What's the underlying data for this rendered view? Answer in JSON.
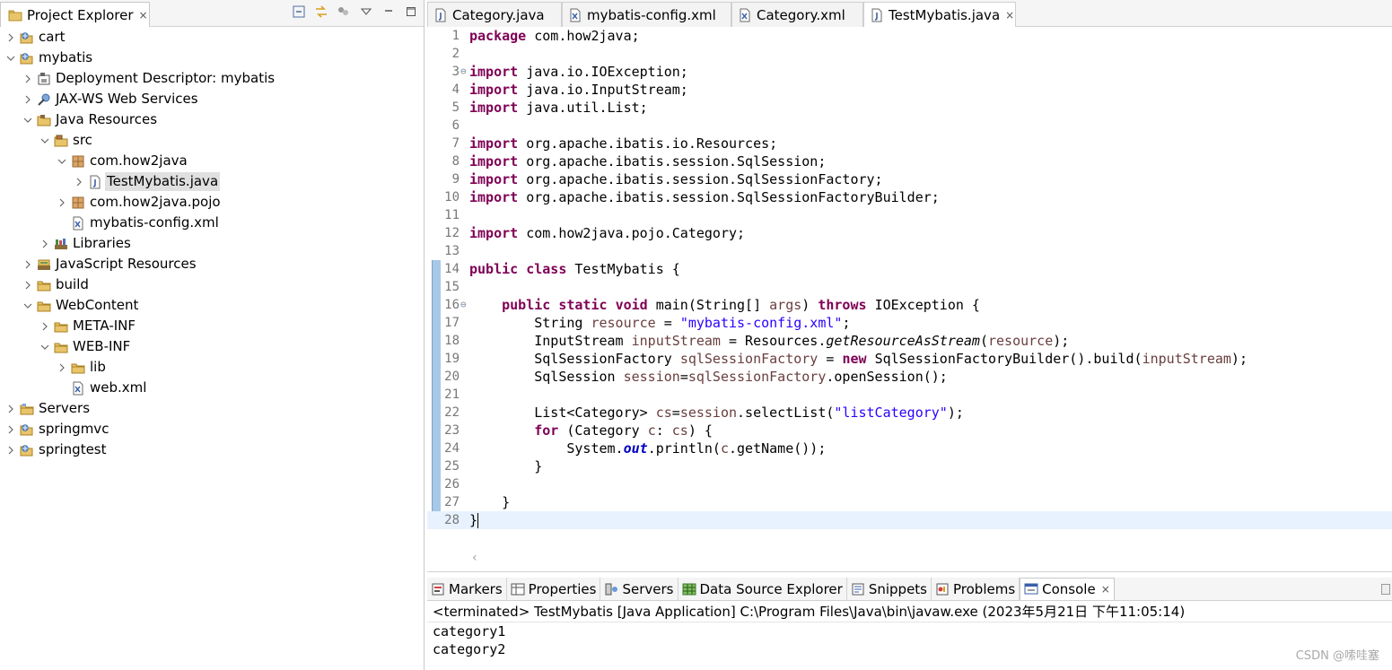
{
  "explorer": {
    "tab_label": "Project Explorer",
    "close_glyph": "×",
    "toolbar_icons": [
      "collapse-all-icon",
      "link-with-editor-icon",
      "filter-icon",
      "view-menu-icon",
      "minimize-icon",
      "maximize-icon"
    ],
    "tree": [
      {
        "label": "cart",
        "level": 0,
        "state": "collapsed",
        "icon": "web-project-icon"
      },
      {
        "label": "mybatis",
        "level": 0,
        "state": "expanded",
        "icon": "web-project-icon"
      },
      {
        "label": "Deployment Descriptor: mybatis",
        "level": 1,
        "state": "collapsed",
        "icon": "deployment-descriptor-icon"
      },
      {
        "label": "JAX-WS Web Services",
        "level": 1,
        "state": "collapsed",
        "icon": "web-services-icon"
      },
      {
        "label": "Java Resources",
        "level": 1,
        "state": "expanded",
        "icon": "java-resources-icon"
      },
      {
        "label": "src",
        "level": 2,
        "state": "expanded",
        "icon": "source-folder-icon"
      },
      {
        "label": "com.how2java",
        "level": 3,
        "state": "expanded",
        "icon": "package-icon"
      },
      {
        "label": "TestMybatis.java",
        "level": 4,
        "state": "collapsed",
        "icon": "java-file-icon",
        "selected": true
      },
      {
        "label": "com.how2java.pojo",
        "level": 3,
        "state": "collapsed",
        "icon": "package-icon"
      },
      {
        "label": "mybatis-config.xml",
        "level": 3,
        "state": "leaf",
        "icon": "xml-file-icon"
      },
      {
        "label": "Libraries",
        "level": 2,
        "state": "collapsed",
        "icon": "libraries-icon"
      },
      {
        "label": "JavaScript Resources",
        "level": 1,
        "state": "collapsed",
        "icon": "javascript-resources-icon"
      },
      {
        "label": "build",
        "level": 1,
        "state": "collapsed",
        "icon": "folder-icon"
      },
      {
        "label": "WebContent",
        "level": 1,
        "state": "expanded",
        "icon": "folder-icon"
      },
      {
        "label": "META-INF",
        "level": 2,
        "state": "collapsed",
        "icon": "folder-icon"
      },
      {
        "label": "WEB-INF",
        "level": 2,
        "state": "expanded",
        "icon": "folder-icon"
      },
      {
        "label": "lib",
        "level": 3,
        "state": "collapsed",
        "icon": "folder-icon"
      },
      {
        "label": "web.xml",
        "level": 3,
        "state": "leaf",
        "icon": "xml-file-icon"
      },
      {
        "label": "Servers",
        "level": 0,
        "state": "collapsed",
        "icon": "servers-folder-icon"
      },
      {
        "label": "springmvc",
        "level": 0,
        "state": "collapsed",
        "icon": "web-project-icon"
      },
      {
        "label": "springtest",
        "level": 0,
        "state": "collapsed",
        "icon": "web-project-icon"
      }
    ]
  },
  "editor": {
    "tabs": [
      {
        "label": "Category.java",
        "icon": "java-file-icon",
        "active": false
      },
      {
        "label": "mybatis-config.xml",
        "icon": "xml-file-icon",
        "active": false
      },
      {
        "label": "Category.xml",
        "icon": "xml-file-icon",
        "active": false
      },
      {
        "label": "TestMybatis.java",
        "icon": "java-file-icon",
        "active": true
      }
    ],
    "current_line": 28,
    "fold_lines": [
      3,
      16
    ],
    "lines": [
      [
        [
          "kw",
          "package"
        ],
        [
          "",
          "com.how2java;"
        ]
      ],
      [],
      [
        [
          "kw",
          "import"
        ],
        [
          "",
          "java.io.IOException;"
        ]
      ],
      [
        [
          "kw",
          "import"
        ],
        [
          "",
          "java.io.InputStream;"
        ]
      ],
      [
        [
          "kw",
          "import"
        ],
        [
          "",
          "java.util.List;"
        ]
      ],
      [],
      [
        [
          "kw",
          "import"
        ],
        [
          "",
          "org.apache.ibatis.io.Resources;"
        ]
      ],
      [
        [
          "kw",
          "import"
        ],
        [
          "",
          "org.apache.ibatis.session.SqlSession;"
        ]
      ],
      [
        [
          "kw",
          "import"
        ],
        [
          "",
          "org.apache.ibatis.session.SqlSessionFactory;"
        ]
      ],
      [
        [
          "kw",
          "import"
        ],
        [
          "",
          "org.apache.ibatis.session.SqlSessionFactoryBuilder;"
        ]
      ],
      [],
      [
        [
          "kw",
          "import"
        ],
        [
          "",
          "com.how2java.pojo.Category;"
        ]
      ],
      [],
      [
        [
          "kw",
          "public"
        ],
        [
          "",
          ""
        ],
        [
          "kw",
          "class"
        ],
        [
          "",
          "TestMybatis {"
        ]
      ],
      [],
      [
        [
          "",
          "    "
        ],
        [
          "kw",
          "public"
        ],
        [
          "",
          ""
        ],
        [
          "kw",
          "static"
        ],
        [
          "",
          ""
        ],
        [
          "kw",
          "void"
        ],
        [
          "",
          "main(String[] "
        ],
        [
          "var",
          "args"
        ],
        [
          "",
          ") "
        ],
        [
          "kw",
          "throws"
        ],
        [
          "",
          "IOException {"
        ]
      ],
      [
        [
          "",
          "        String "
        ],
        [
          "var",
          "resource"
        ],
        [
          "",
          " = "
        ],
        [
          "str",
          "\"mybatis-config.xml\""
        ],
        [
          "",
          ";"
        ]
      ],
      [
        [
          "",
          "        InputStream "
        ],
        [
          "var",
          "inputStream"
        ],
        [
          "",
          " = Resources."
        ],
        [
          "it",
          "getResourceAsStream"
        ],
        [
          "",
          "("
        ],
        [
          "var",
          "resource"
        ],
        [
          "",
          ");"
        ]
      ],
      [
        [
          "",
          "        SqlSessionFactory "
        ],
        [
          "var",
          "sqlSessionFactory"
        ],
        [
          "",
          " = "
        ],
        [
          "kw",
          "new"
        ],
        [
          "",
          "SqlSessionFactoryBuilder().build("
        ],
        [
          "var",
          "inputStream"
        ],
        [
          "",
          ");"
        ]
      ],
      [
        [
          "",
          "        SqlSession "
        ],
        [
          "var",
          "session"
        ],
        [
          "",
          "="
        ],
        [
          "var",
          "sqlSessionFactory"
        ],
        [
          "",
          ".openSession();"
        ]
      ],
      [],
      [
        [
          "",
          "        List<Category> "
        ],
        [
          "var",
          "cs"
        ],
        [
          "",
          "="
        ],
        [
          "var",
          "session"
        ],
        [
          "",
          ".selectList("
        ],
        [
          "str",
          "\"listCategory\""
        ],
        [
          "",
          ");"
        ]
      ],
      [
        [
          "",
          "        "
        ],
        [
          "kw",
          "for"
        ],
        [
          "",
          "(Category "
        ],
        [
          "var",
          "c"
        ],
        [
          "",
          ": "
        ],
        [
          "var",
          "cs"
        ],
        [
          "",
          ") {"
        ]
      ],
      [
        [
          "",
          "            System."
        ],
        [
          "fld",
          "out"
        ],
        [
          "",
          ".println("
        ],
        [
          "var",
          "c"
        ],
        [
          "",
          ".getName());"
        ]
      ],
      [
        [
          "",
          "        }"
        ]
      ],
      [],
      [
        [
          "",
          "    }"
        ]
      ],
      [
        [
          "",
          "}"
        ]
      ]
    ]
  },
  "console": {
    "tabs": [
      {
        "label": "Markers",
        "icon": "markers-icon"
      },
      {
        "label": "Properties",
        "icon": "properties-icon"
      },
      {
        "label": "Servers",
        "icon": "servers-icon"
      },
      {
        "label": "Data Source Explorer",
        "icon": "data-source-icon"
      },
      {
        "label": "Snippets",
        "icon": "snippets-icon"
      },
      {
        "label": "Problems",
        "icon": "problems-icon"
      },
      {
        "label": "Console",
        "icon": "console-icon",
        "active": true
      }
    ],
    "terminated": "<terminated> TestMybatis [Java Application] C:\\Program Files\\Java\\bin\\javaw.exe (2023年5月21日 下午11:05:14)",
    "output": [
      "category1",
      "category2"
    ],
    "watermark": "CSDN @嗦哇塞"
  }
}
